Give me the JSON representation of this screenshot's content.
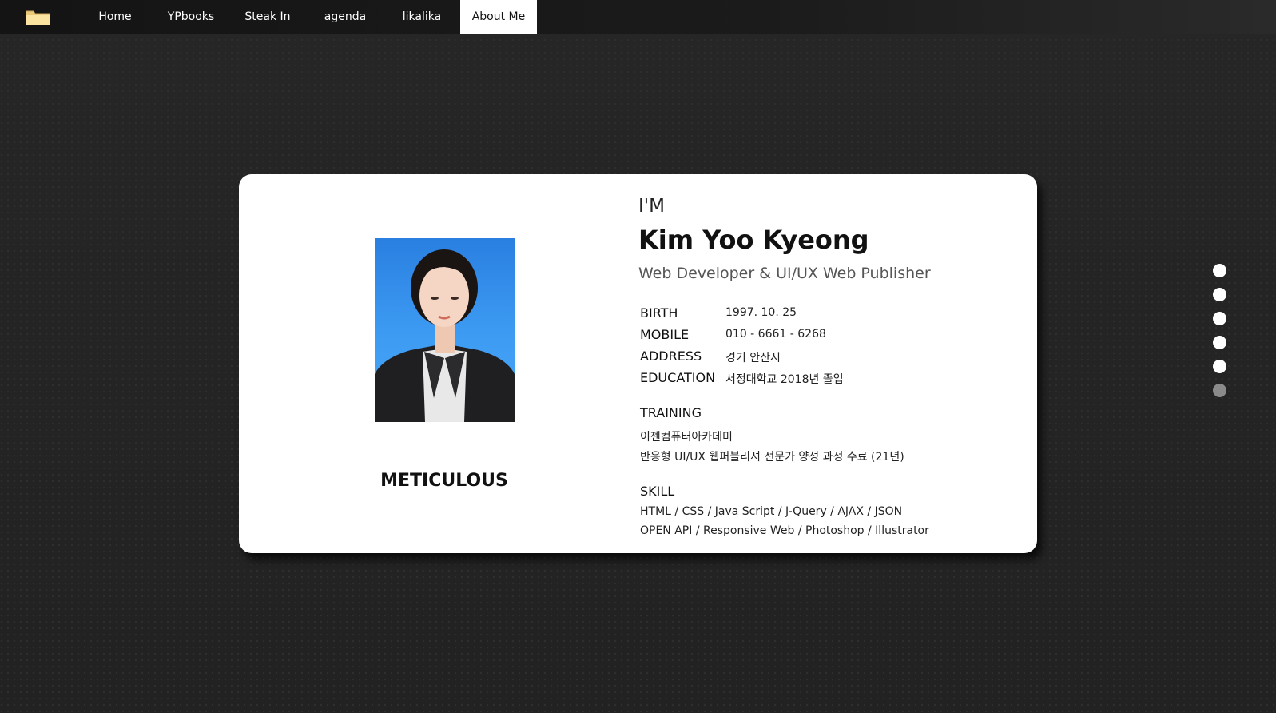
{
  "nav": {
    "logo_icon": "folder-icon",
    "items": [
      {
        "label": "Home"
      },
      {
        "label": "YPbooks"
      },
      {
        "label": "Steak In"
      },
      {
        "label": "agenda"
      },
      {
        "label": "likalika"
      },
      {
        "label": "About Me",
        "active": true
      }
    ]
  },
  "profile": {
    "photo_alt": "profile photo",
    "trait": "METICULOUS",
    "intro": "I'M",
    "name": "Kim Yoo Kyeong",
    "role": "Web Developer & UI/UX Web Publisher",
    "details": [
      {
        "label": "BIRTH",
        "value": "1997. 10. 25"
      },
      {
        "label": "MOBILE",
        "value": "010 - 6661 - 6268"
      },
      {
        "label": "ADDRESS",
        "value": "경기 안산시"
      },
      {
        "label": "EDUCATION",
        "value": "서정대학교 2018년 졸업"
      }
    ],
    "training": {
      "title": "TRAINING",
      "lines": [
        "이젠컴퓨터아카데미",
        "반응형 UI/UX 웹퍼블리셔 전문가 양성 과정 수료 (21년)"
      ]
    },
    "skill": {
      "title": "SKILL",
      "lines": [
        "HTML / CSS / Java Script / J-Query / AJAX / JSON",
        "OPEN API / Responsive Web / Photoshop / Illustrator"
      ]
    }
  },
  "pager": {
    "count": 6,
    "active_index": 5
  },
  "colors": {
    "background": "#242424",
    "card": "#ffffff",
    "nav_active_bg": "#ffffff",
    "dot": "#ffffff",
    "dot_active": "#8a8a8a",
    "photo_bg": "#3c9af2"
  }
}
